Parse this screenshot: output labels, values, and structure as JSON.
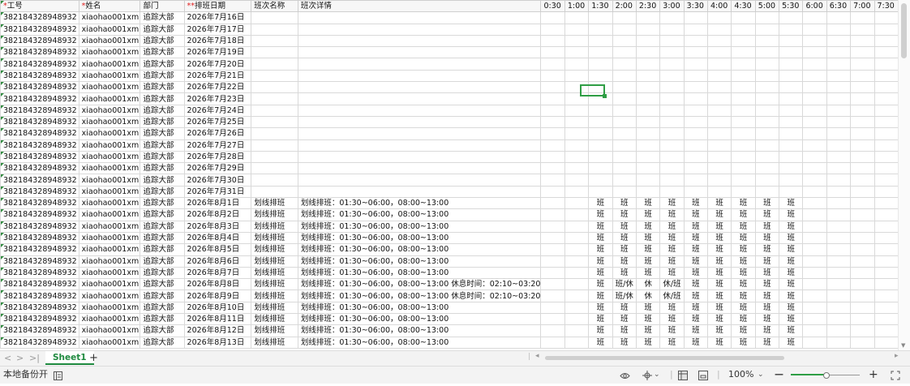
{
  "headers": [
    {
      "label": "工号",
      "required": "*"
    },
    {
      "label": "姓名",
      "required": "*"
    },
    {
      "label": "部门",
      "required": ""
    },
    {
      "label": "排班日期",
      "required": "**"
    },
    {
      "label": "班次名称",
      "required": ""
    },
    {
      "label": "班次详情",
      "required": ""
    }
  ],
  "time_columns": [
    "0:30",
    "1:00",
    "1:30",
    "2:00",
    "2:30",
    "3:00",
    "3:30",
    "4:00",
    "4:30",
    "5:00",
    "5:30",
    "6:00",
    "6:30",
    "7:00",
    "7:30"
  ],
  "rows": [
    {
      "id": "382184328948932",
      "name": "xiaohao001xm",
      "dept": "追踪大部",
      "date": "2026年7月16日",
      "shift": "",
      "detail": "",
      "cells": []
    },
    {
      "id": "382184328948932",
      "name": "xiaohao001xm",
      "dept": "追踪大部",
      "date": "2026年7月17日",
      "shift": "",
      "detail": "",
      "cells": []
    },
    {
      "id": "382184328948932",
      "name": "xiaohao001xm",
      "dept": "追踪大部",
      "date": "2026年7月18日",
      "shift": "",
      "detail": "",
      "cells": []
    },
    {
      "id": "382184328948932",
      "name": "xiaohao001xm",
      "dept": "追踪大部",
      "date": "2026年7月19日",
      "shift": "",
      "detail": "",
      "cells": []
    },
    {
      "id": "382184328948932",
      "name": "xiaohao001xm",
      "dept": "追踪大部",
      "date": "2026年7月20日",
      "shift": "",
      "detail": "",
      "cells": []
    },
    {
      "id": "382184328948932",
      "name": "xiaohao001xm",
      "dept": "追踪大部",
      "date": "2026年7月21日",
      "shift": "",
      "detail": "",
      "cells": []
    },
    {
      "id": "382184328948932",
      "name": "xiaohao001xm",
      "dept": "追踪大部",
      "date": "2026年7月22日",
      "shift": "",
      "detail": "",
      "cells": []
    },
    {
      "id": "382184328948932",
      "name": "xiaohao001xm",
      "dept": "追踪大部",
      "date": "2026年7月23日",
      "shift": "",
      "detail": "",
      "cells": []
    },
    {
      "id": "382184328948932",
      "name": "xiaohao001xm",
      "dept": "追踪大部",
      "date": "2026年7月24日",
      "shift": "",
      "detail": "",
      "cells": []
    },
    {
      "id": "382184328948932",
      "name": "xiaohao001xm",
      "dept": "追踪大部",
      "date": "2026年7月25日",
      "shift": "",
      "detail": "",
      "cells": []
    },
    {
      "id": "382184328948932",
      "name": "xiaohao001xm",
      "dept": "追踪大部",
      "date": "2026年7月26日",
      "shift": "",
      "detail": "",
      "cells": []
    },
    {
      "id": "382184328948932",
      "name": "xiaohao001xm",
      "dept": "追踪大部",
      "date": "2026年7月27日",
      "shift": "",
      "detail": "",
      "cells": []
    },
    {
      "id": "382184328948932",
      "name": "xiaohao001xm",
      "dept": "追踪大部",
      "date": "2026年7月28日",
      "shift": "",
      "detail": "",
      "cells": []
    },
    {
      "id": "382184328948932",
      "name": "xiaohao001xm",
      "dept": "追踪大部",
      "date": "2026年7月29日",
      "shift": "",
      "detail": "",
      "cells": []
    },
    {
      "id": "382184328948932",
      "name": "xiaohao001xm",
      "dept": "追踪大部",
      "date": "2026年7月30日",
      "shift": "",
      "detail": "",
      "cells": []
    },
    {
      "id": "382184328948932",
      "name": "xiaohao001xm",
      "dept": "追踪大部",
      "date": "2026年7月31日",
      "shift": "",
      "detail": "",
      "cells": []
    },
    {
      "id": "382184328948932",
      "name": "xiaohao001xm",
      "dept": "追踪大部",
      "date": "2026年8月1日",
      "shift": "划线排班",
      "detail": "划线排班：01:30~06:00，08:00~13:00",
      "cells": [
        "",
        "",
        "班",
        "班",
        "班",
        "班",
        "班",
        "班",
        "班",
        "班",
        "班",
        "",
        "",
        "",
        ""
      ]
    },
    {
      "id": "382184328948932",
      "name": "xiaohao001xm",
      "dept": "追踪大部",
      "date": "2026年8月2日",
      "shift": "划线排班",
      "detail": "划线排班：01:30~06:00，08:00~13:00",
      "cells": [
        "",
        "",
        "班",
        "班",
        "班",
        "班",
        "班",
        "班",
        "班",
        "班",
        "班",
        "",
        "",
        "",
        ""
      ]
    },
    {
      "id": "382184328948932",
      "name": "xiaohao001xm",
      "dept": "追踪大部",
      "date": "2026年8月3日",
      "shift": "划线排班",
      "detail": "划线排班：01:30~06:00，08:00~13:00",
      "cells": [
        "",
        "",
        "班",
        "班",
        "班",
        "班",
        "班",
        "班",
        "班",
        "班",
        "班",
        "",
        "",
        "",
        ""
      ]
    },
    {
      "id": "382184328948932",
      "name": "xiaohao001xm",
      "dept": "追踪大部",
      "date": "2026年8月4日",
      "shift": "划线排班",
      "detail": "划线排班：01:30~06:00，08:00~13:00",
      "cells": [
        "",
        "",
        "班",
        "班",
        "班",
        "班",
        "班",
        "班",
        "班",
        "班",
        "班",
        "",
        "",
        "",
        ""
      ]
    },
    {
      "id": "382184328948932",
      "name": "xiaohao001xm",
      "dept": "追踪大部",
      "date": "2026年8月5日",
      "shift": "划线排班",
      "detail": "划线排班：01:30~06:00，08:00~13:00",
      "cells": [
        "",
        "",
        "班",
        "班",
        "班",
        "班",
        "班",
        "班",
        "班",
        "班",
        "班",
        "",
        "",
        "",
        ""
      ]
    },
    {
      "id": "382184328948932",
      "name": "xiaohao001xm",
      "dept": "追踪大部",
      "date": "2026年8月6日",
      "shift": "划线排班",
      "detail": "划线排班：01:30~06:00，08:00~13:00",
      "cells": [
        "",
        "",
        "班",
        "班",
        "班",
        "班",
        "班",
        "班",
        "班",
        "班",
        "班",
        "",
        "",
        "",
        ""
      ]
    },
    {
      "id": "382184328948932",
      "name": "xiaohao001xm",
      "dept": "追踪大部",
      "date": "2026年8月7日",
      "shift": "划线排班",
      "detail": "划线排班：01:30~06:00，08:00~13:00",
      "cells": [
        "",
        "",
        "班",
        "班",
        "班",
        "班",
        "班",
        "班",
        "班",
        "班",
        "班",
        "",
        "",
        "",
        ""
      ]
    },
    {
      "id": "382184328948932",
      "name": "xiaohao001xm",
      "dept": "追踪大部",
      "date": "2026年8月8日",
      "shift": "划线排班",
      "detail": "划线排班：01:30~06:00，08:00~13:00 休息时间：02:10~03:20",
      "cells": [
        "",
        "",
        "班",
        "班/休",
        "休",
        "休/班",
        "班",
        "班",
        "班",
        "班",
        "班",
        "",
        "",
        "",
        ""
      ]
    },
    {
      "id": "382184328948932",
      "name": "xiaohao001xm",
      "dept": "追踪大部",
      "date": "2026年8月9日",
      "shift": "划线排班",
      "detail": "划线排班：01:30~06:00，08:00~13:00 休息时间：02:10~03:20",
      "cells": [
        "",
        "",
        "班",
        "班/休",
        "休",
        "休/班",
        "班",
        "班",
        "班",
        "班",
        "班",
        "",
        "",
        "",
        ""
      ]
    },
    {
      "id": "382184328948932",
      "name": "xiaohao001xm",
      "dept": "追踪大部",
      "date": "2026年8月10日",
      "shift": "划线排班",
      "detail": "划线排班：01:30~06:00，08:00~13:00",
      "cells": [
        "",
        "",
        "班",
        "班",
        "班",
        "班",
        "班",
        "班",
        "班",
        "班",
        "班",
        "",
        "",
        "",
        ""
      ]
    },
    {
      "id": "382184328948932",
      "name": "xiaohao001xm",
      "dept": "追踪大部",
      "date": "2026年8月11日",
      "shift": "划线排班",
      "detail": "划线排班：01:30~06:00，08:00~13:00",
      "cells": [
        "",
        "",
        "班",
        "班",
        "班",
        "班",
        "班",
        "班",
        "班",
        "班",
        "班",
        "",
        "",
        "",
        ""
      ]
    },
    {
      "id": "382184328948932",
      "name": "xiaohao001xm",
      "dept": "追踪大部",
      "date": "2026年8月12日",
      "shift": "划线排班",
      "detail": "划线排班：01:30~06:00，08:00~13:00",
      "cells": [
        "",
        "",
        "班",
        "班",
        "班",
        "班",
        "班",
        "班",
        "班",
        "班",
        "班",
        "",
        "",
        "",
        ""
      ]
    },
    {
      "id": "382184328948932",
      "name": "xiaohao001xm",
      "dept": "追踪大部",
      "date": "2026年8月13日",
      "shift": "划线排班",
      "detail": "划线排班：01:30~06:00，08:00~13:00",
      "cells": [
        "",
        "",
        "班",
        "班",
        "班",
        "班",
        "班",
        "班",
        "班",
        "班",
        "班",
        "",
        "",
        "",
        ""
      ]
    }
  ],
  "sheet_tab": "Sheet1",
  "add_sheet": "+",
  "nav": {
    "first": "<",
    "prev": ">",
    "last": ">|"
  },
  "status": {
    "backup": "本地备份开",
    "zoom": "100%",
    "zoom_level": 0.5,
    "zoom_minus": "—",
    "zoom_plus": "+",
    "caret": "⌄"
  },
  "icons": [
    "eye-icon",
    "crosshair-icon",
    "normal-view-icon",
    "page-layout-icon",
    "fullscreen-icon",
    "sidebar-toggle-icon"
  ],
  "colors": {
    "accent": "#1f8a3f",
    "required": "#e02020",
    "selection": "#2f9e45"
  }
}
